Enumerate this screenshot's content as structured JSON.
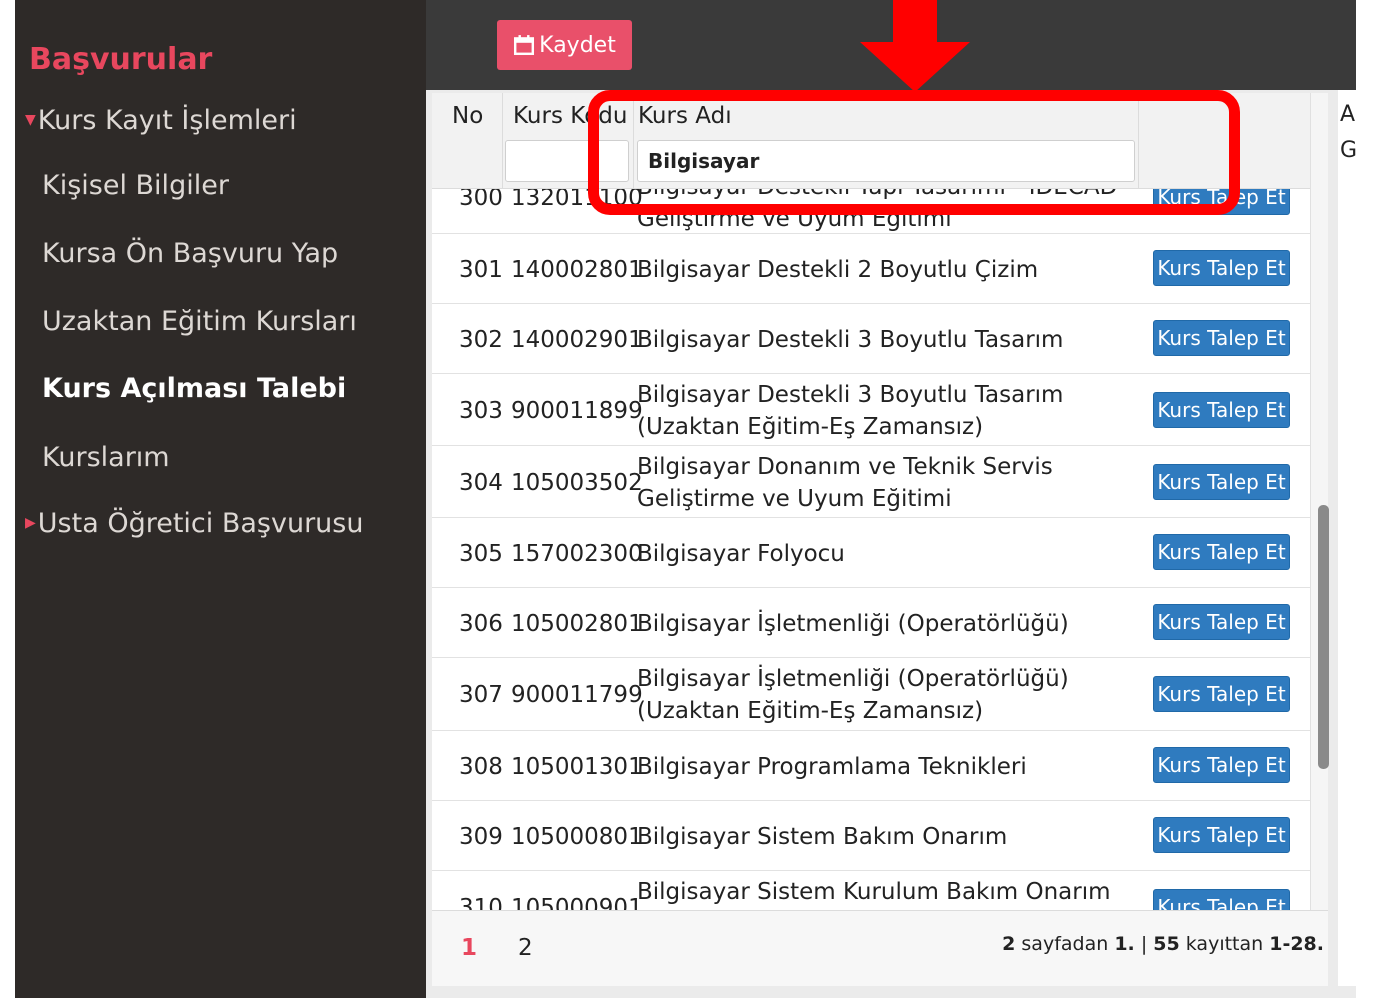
{
  "sidebar": {
    "title": "Başvurular",
    "group_main": "Kurs Kayıt İşlemleri",
    "items": [
      "Kişisel Bilgiler",
      "Kursa Ön Başvuru Yap",
      "Uzaktan Eğitim Kursları",
      "Kurs Açılması Talebi",
      "Kurslarım"
    ],
    "active_item": "Kurs Açılması Talebi",
    "group_other": "Usta Öğretici Başvurusu"
  },
  "toolbar": {
    "save_label": "Kaydet"
  },
  "grid": {
    "headers": {
      "no": "No",
      "code": "Kurs Kodu",
      "name": "Kurs Adı"
    },
    "filters": {
      "code": "",
      "name": "Bilgisayar"
    },
    "action_label": "Kurs Talep Et",
    "rows": [
      {
        "no": "300",
        "code": "132011100",
        "name": "Bilgisayar Destekli Yapı Tasarımı - IDECAD Geliştirme ve Uyum Eğitimi"
      },
      {
        "no": "301",
        "code": "140002801",
        "name": "Bilgisayar Destekli 2 Boyutlu Çizim"
      },
      {
        "no": "302",
        "code": "140002901",
        "name": "Bilgisayar Destekli 3 Boyutlu Tasarım"
      },
      {
        "no": "303",
        "code": "900011899",
        "name": "Bilgisayar Destekli 3 Boyutlu Tasarım (Uzaktan Eğitim-Eş Zamansız)"
      },
      {
        "no": "304",
        "code": "105003502",
        "name": "Bilgisayar Donanım ve Teknik Servis Geliştirme ve Uyum Eğitimi"
      },
      {
        "no": "305",
        "code": "157002300",
        "name": "Bilgisayar Folyocu"
      },
      {
        "no": "306",
        "code": "105002801",
        "name": "Bilgisayar İşletmenliği (Operatörlüğü)"
      },
      {
        "no": "307",
        "code": "900011799",
        "name": "Bilgisayar İşletmenliği (Operatörlüğü) (Uzaktan Eğitim-Eş Zamansız)"
      },
      {
        "no": "308",
        "code": "105001301",
        "name": "Bilgisayar Programlama Teknikleri"
      },
      {
        "no": "309",
        "code": "105000801",
        "name": "Bilgisayar Sistem Bakım Onarım"
      },
      {
        "no": "310",
        "code": "105000901",
        "name": "Bilgisayar Sistem Kurulum Bakım Onarım Ve"
      }
    ]
  },
  "pager": {
    "pages": [
      "1",
      "2"
    ],
    "current_page": "1",
    "total_pages": "2",
    "current": "1.",
    "total_records": "55",
    "range": "1-28.",
    "text_sayfadan": "sayfadan",
    "text_kayittan": "kayıttan"
  },
  "right_column": {
    "header_initial": "A",
    "filter_initial": "G"
  },
  "colors": {
    "accent": "#e8475e",
    "button_blue": "#2f7bbf",
    "sidebar_bg": "#2e2a28",
    "annotation_red": "#ff0000"
  },
  "icons": {
    "save": "calendar-save-icon",
    "annotation": "down-arrow-icon"
  }
}
